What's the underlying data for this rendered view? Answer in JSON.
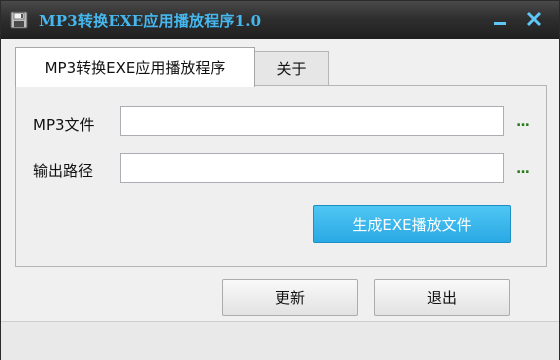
{
  "window": {
    "title": "MP3转换EXE应用播放程序1.0",
    "title_color": "#45b8f0",
    "app_icon": "floppy-disk-icon",
    "minimize_icon": "minimize-icon",
    "close_icon": "close-icon"
  },
  "tabs": [
    {
      "label": "MP3转换EXE应用播放程序",
      "active": true
    },
    {
      "label": "关于",
      "active": false
    }
  ],
  "form": {
    "mp3_label": "MP3文件",
    "mp3_value": "",
    "output_label": "输出路径",
    "output_value": "",
    "browse_label": "...",
    "convert_label": "生成EXE播放文件",
    "convert_color": "#2aa9e4"
  },
  "footer": {
    "refresh_label": "更新",
    "exit_label": "退出"
  }
}
